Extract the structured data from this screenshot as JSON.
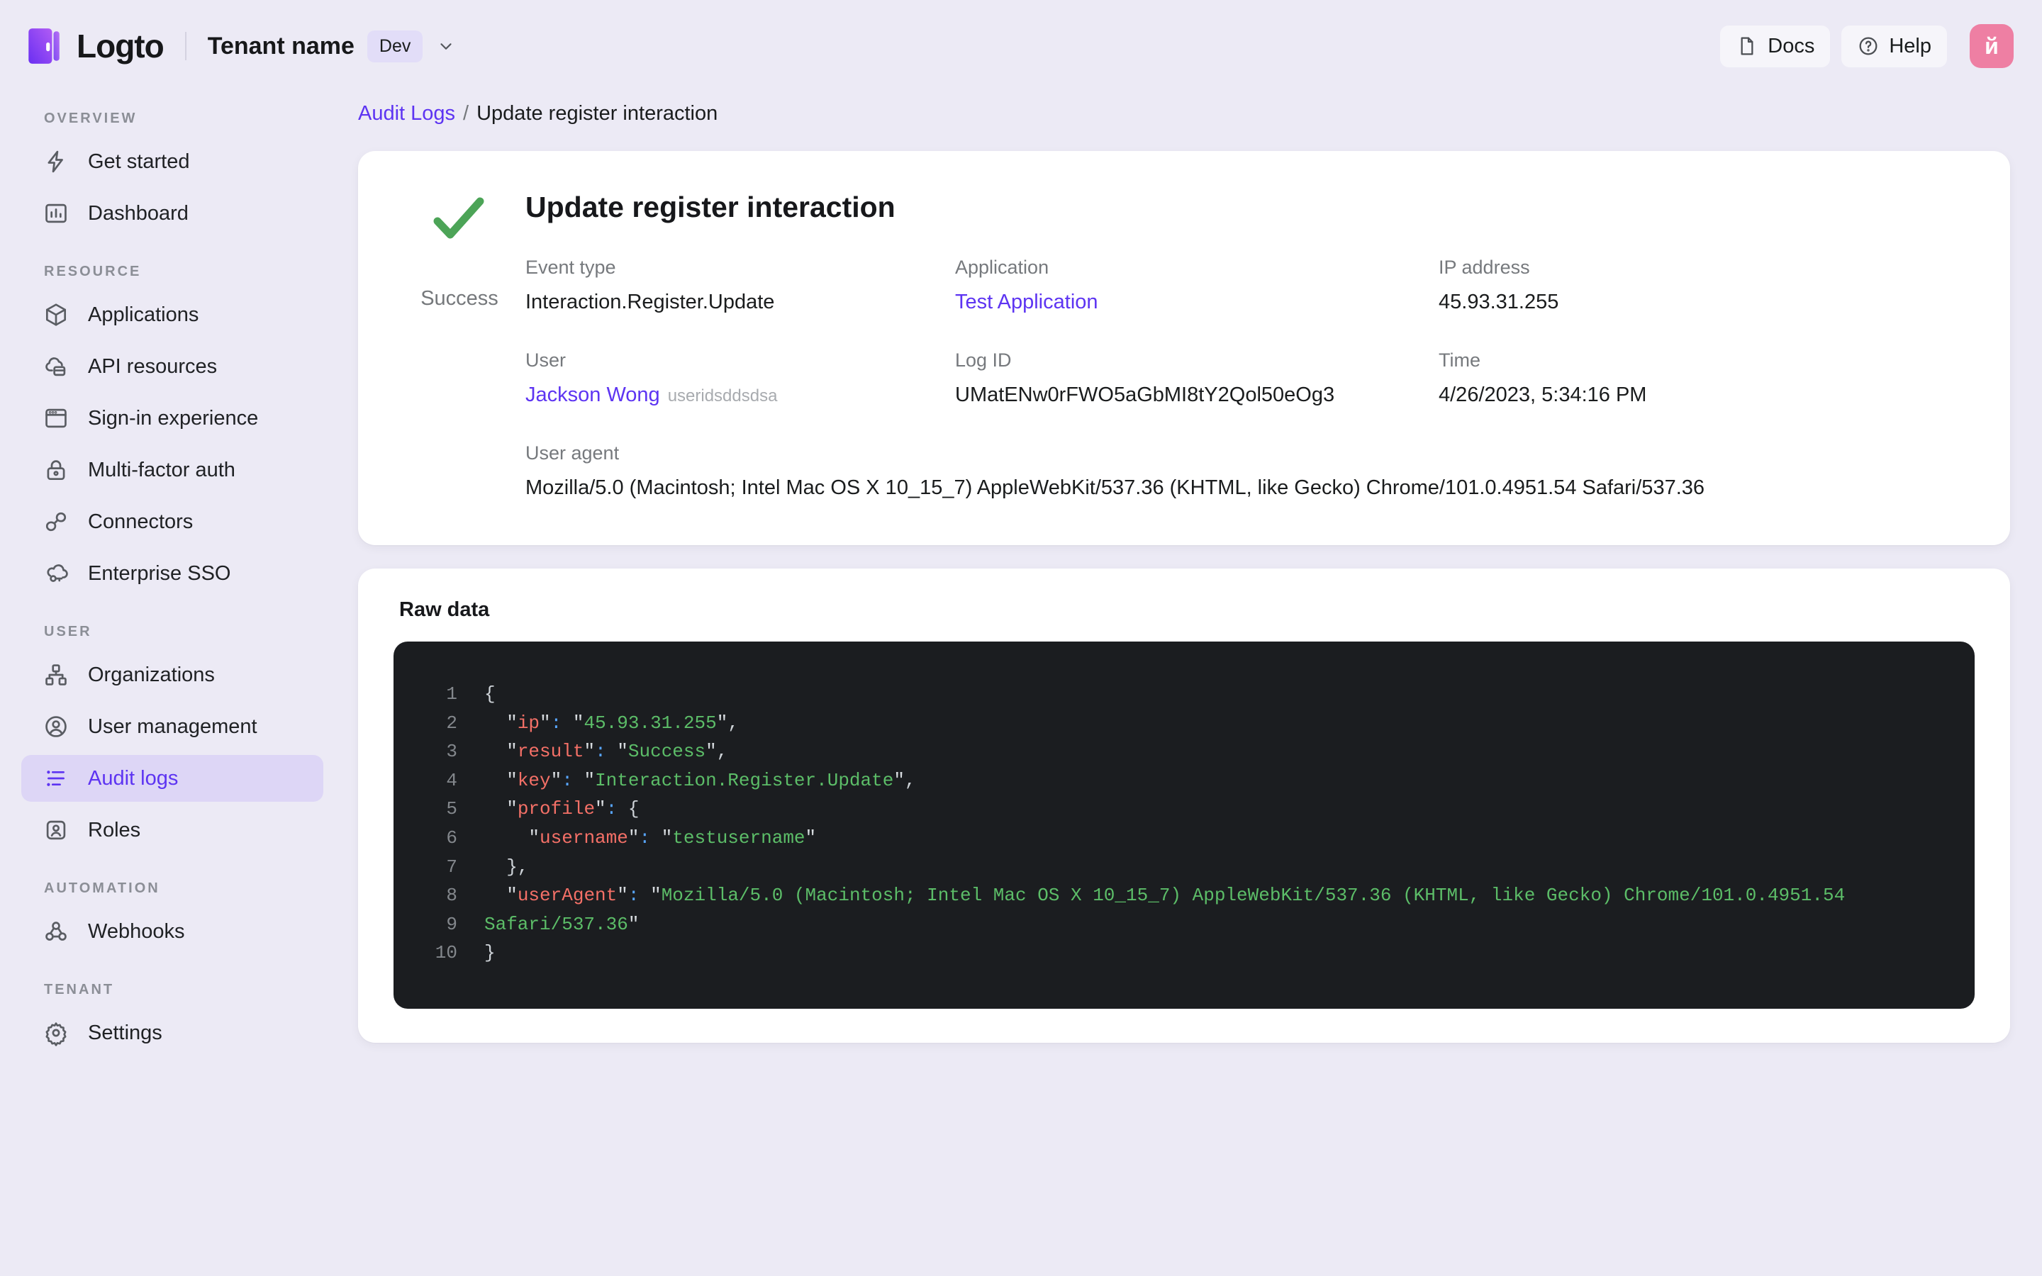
{
  "colors": {
    "accent": "#5d34f2",
    "page_bg": "#eceaf5",
    "active_item_bg": "#ddd6f6",
    "success_green": "#4ca457",
    "avatar_pink": "#ee7fa3",
    "code_bg": "#1b1d20",
    "code_key": "#f47067",
    "code_string": "#5cbd68",
    "code_colon": "#58a6ff"
  },
  "topbar": {
    "logo_text": "Logto",
    "tenant_name": "Tenant name",
    "env_badge": "Dev",
    "docs_label": "Docs",
    "help_label": "Help",
    "avatar_initial": "й"
  },
  "sidebar": {
    "sections": [
      {
        "label": "OVERVIEW",
        "items": [
          {
            "label": "Get started"
          },
          {
            "label": "Dashboard"
          }
        ]
      },
      {
        "label": "RESOURCE",
        "items": [
          {
            "label": "Applications"
          },
          {
            "label": "API resources"
          },
          {
            "label": "Sign-in experience"
          },
          {
            "label": "Multi-factor auth"
          },
          {
            "label": "Connectors"
          },
          {
            "label": "Enterprise SSO"
          }
        ]
      },
      {
        "label": "USER",
        "items": [
          {
            "label": "Organizations"
          },
          {
            "label": "User management"
          },
          {
            "label": "Audit logs",
            "active": true
          },
          {
            "label": "Roles"
          }
        ]
      },
      {
        "label": "AUTOMATION",
        "items": [
          {
            "label": "Webhooks"
          }
        ]
      },
      {
        "label": "TENANT",
        "items": [
          {
            "label": "Settings"
          }
        ]
      }
    ]
  },
  "breadcrumb": {
    "parent": "Audit Logs",
    "separator": "/",
    "current": "Update register interaction"
  },
  "event": {
    "title": "Update register interaction",
    "status": "Success",
    "details": {
      "event_type": {
        "label": "Event type",
        "value": "Interaction.Register.Update"
      },
      "application": {
        "label": "Application",
        "value": "Test Application"
      },
      "ip": {
        "label": "IP address",
        "value": "45.93.31.255"
      },
      "user": {
        "label": "User",
        "value": "Jackson Wong",
        "suffix": "useridsddsdsa"
      },
      "log_id": {
        "label": "Log ID",
        "value": "UMatENw0rFWO5aGbMI8tY2Qol50eOg3"
      },
      "time": {
        "label": "Time",
        "value": "4/26/2023, 5:34:16 PM"
      },
      "user_agent": {
        "label": "User agent",
        "value": "Mozilla/5.0 (Macintosh; Intel Mac OS X 10_15_7) AppleWebKit/537.36 (KHTML, like Gecko) Chrome/101.0.4951.54 Safari/537.36"
      }
    }
  },
  "raw": {
    "title": "Raw data",
    "lines": [
      {
        "n": "1",
        "tokens": [
          {
            "t": "punc",
            "v": "{"
          }
        ]
      },
      {
        "n": "2",
        "tokens": [
          {
            "t": "punc",
            "v": "  "
          },
          {
            "t": "q",
            "v": "\""
          },
          {
            "t": "key",
            "v": "ip"
          },
          {
            "t": "q",
            "v": "\""
          },
          {
            "t": "col",
            "v": ":"
          },
          {
            "t": "punc",
            "v": " "
          },
          {
            "t": "q",
            "v": "\""
          },
          {
            "t": "str",
            "v": "45.93.31.255"
          },
          {
            "t": "q",
            "v": "\""
          },
          {
            "t": "punc",
            "v": ","
          }
        ]
      },
      {
        "n": "3",
        "tokens": [
          {
            "t": "punc",
            "v": "  "
          },
          {
            "t": "q",
            "v": "\""
          },
          {
            "t": "key",
            "v": "result"
          },
          {
            "t": "q",
            "v": "\""
          },
          {
            "t": "col",
            "v": ":"
          },
          {
            "t": "punc",
            "v": " "
          },
          {
            "t": "q",
            "v": "\""
          },
          {
            "t": "str",
            "v": "Success"
          },
          {
            "t": "q",
            "v": "\""
          },
          {
            "t": "punc",
            "v": ","
          }
        ]
      },
      {
        "n": "4",
        "tokens": [
          {
            "t": "punc",
            "v": "  "
          },
          {
            "t": "q",
            "v": "\""
          },
          {
            "t": "key",
            "v": "key"
          },
          {
            "t": "q",
            "v": "\""
          },
          {
            "t": "col",
            "v": ":"
          },
          {
            "t": "punc",
            "v": " "
          },
          {
            "t": "q",
            "v": "\""
          },
          {
            "t": "str",
            "v": "Interaction.Register.Update"
          },
          {
            "t": "q",
            "v": "\""
          },
          {
            "t": "punc",
            "v": ","
          }
        ]
      },
      {
        "n": "5",
        "tokens": [
          {
            "t": "punc",
            "v": "  "
          },
          {
            "t": "q",
            "v": "\""
          },
          {
            "t": "key",
            "v": "profile"
          },
          {
            "t": "q",
            "v": "\""
          },
          {
            "t": "col",
            "v": ":"
          },
          {
            "t": "punc",
            "v": " {"
          }
        ]
      },
      {
        "n": "6",
        "tokens": [
          {
            "t": "punc",
            "v": "    "
          },
          {
            "t": "q",
            "v": "\""
          },
          {
            "t": "key",
            "v": "username"
          },
          {
            "t": "q",
            "v": "\""
          },
          {
            "t": "col",
            "v": ":"
          },
          {
            "t": "punc",
            "v": " "
          },
          {
            "t": "q",
            "v": "\""
          },
          {
            "t": "str",
            "v": "testusername"
          },
          {
            "t": "q",
            "v": "\""
          }
        ]
      },
      {
        "n": "7",
        "tokens": [
          {
            "t": "punc",
            "v": "  },"
          }
        ]
      },
      {
        "n": "8",
        "tokens": [
          {
            "t": "punc",
            "v": "  "
          },
          {
            "t": "q",
            "v": "\""
          },
          {
            "t": "key",
            "v": "userAgent"
          },
          {
            "t": "q",
            "v": "\""
          },
          {
            "t": "col",
            "v": ":"
          },
          {
            "t": "punc",
            "v": " "
          },
          {
            "t": "q",
            "v": "\""
          },
          {
            "t": "str",
            "v": "Mozilla/5.0 (Macintosh; Intel Mac OS X 10_15_7) AppleWebKit/537.36 (KHTML, like Gecko) Chrome/101.0.4951.54"
          }
        ]
      },
      {
        "n": "9",
        "tokens": [
          {
            "t": "str",
            "v": "Safari/537.36"
          },
          {
            "t": "q",
            "v": "\""
          }
        ]
      },
      {
        "n": "10",
        "tokens": [
          {
            "t": "punc",
            "v": "}"
          }
        ]
      }
    ]
  }
}
